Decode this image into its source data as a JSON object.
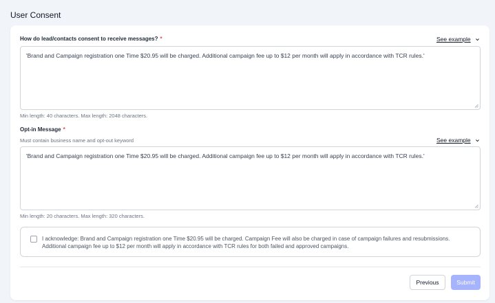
{
  "section": {
    "title": "User Consent"
  },
  "consent_question": {
    "label": "How do lead/contacts consent to receive messages?",
    "required_mark": "*",
    "see_example": "See example",
    "value": "'Brand and Campaign registration one Time $20.95 will be charged. Additional campaign fee up to $12 per month will apply in accordance with TCR rules.'",
    "hint": "Min length: 40 characters. Max length: 2048 characters."
  },
  "optin": {
    "label": "Opt-in Message",
    "required_mark": "*",
    "sublabel": "Must contain business name and opt-out keyword",
    "see_example": "See example",
    "value": "'Brand and Campaign registration one Time $20.95 will be charged. Additional campaign fee up to $12 per month will apply in accordance with TCR rules.'",
    "hint": "Min length: 20 characters. Max length: 320 characters."
  },
  "acknowledge": {
    "checked": false,
    "text": "I acknowledge: Brand and Campaign registration one Time $20.95 will be charged. Campaign Fee will also be charged in case of campaign failures and resubmissions. Additional campaign fee up to $12 per month will apply in accordance with TCR rules for both failed and approved campaigns."
  },
  "footer": {
    "previous_label": "Previous",
    "submit_label": "Submit"
  },
  "colors": {
    "accent_disabled": "#a5b4fc",
    "required": "#ef4444",
    "background": "#f1f4f8"
  },
  "icons": {
    "see_example": "chevron-down-icon",
    "textarea_resize": "resize-handle-icon"
  }
}
